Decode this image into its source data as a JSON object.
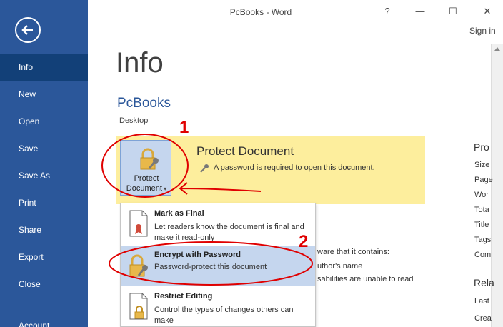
{
  "window": {
    "title": "PcBooks - Word",
    "help": "?",
    "minimize": "—",
    "maximize": "☐",
    "close": "✕",
    "sign_in": "Sign in"
  },
  "sidebar": {
    "items": [
      {
        "label": "Info",
        "active": true
      },
      {
        "label": "New"
      },
      {
        "label": "Open"
      },
      {
        "label": "Save"
      },
      {
        "label": "Save As"
      },
      {
        "label": "Print"
      },
      {
        "label": "Share"
      },
      {
        "label": "Export"
      },
      {
        "label": "Close"
      },
      {
        "label": "Account"
      }
    ]
  },
  "main": {
    "heading": "Info",
    "doc_name": "PcBooks",
    "doc_location": "Desktop",
    "protect": {
      "button_line1": "Protect",
      "button_line2": "Document",
      "title": "Protect Document",
      "description": "A password is required to open this document."
    },
    "background_lines": [
      "ware that it contains:",
      "uthor's name",
      "sabilities are unable to read"
    ]
  },
  "dropdown": {
    "items": [
      {
        "title": "Mark as Final",
        "desc": "Let readers know the document is final and make it read-only"
      },
      {
        "title": "Encrypt with Password",
        "desc": "Password-protect this document"
      },
      {
        "title": "Restrict Editing",
        "desc": "Control the types of changes others can make"
      }
    ]
  },
  "properties": {
    "heading": "Pro",
    "rows": [
      "Size",
      "Page",
      "Wor",
      "Tota",
      "Title",
      "Tags",
      "Com"
    ],
    "related_heading": "Rela",
    "related_rows": [
      "Last",
      "Crea"
    ]
  },
  "annotations": {
    "one": "1",
    "two": "2"
  },
  "colors": {
    "sidebar": "#2b579a",
    "sidebar_active": "#124078",
    "protect_band": "#fdee9d",
    "highlight": "#c5d6ee",
    "annotation_red": "#e00000"
  }
}
